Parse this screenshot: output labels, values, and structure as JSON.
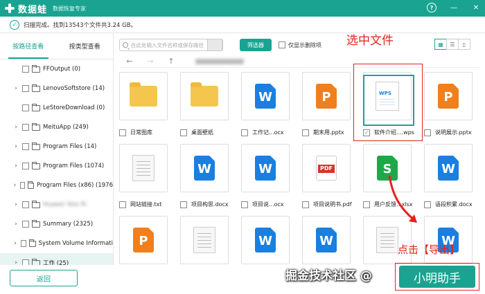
{
  "app": {
    "name": "数据蛙",
    "subtitle": "数据恢复专家"
  },
  "window": {
    "help": "?",
    "minimize": "—",
    "close": "✕"
  },
  "status": {
    "text": "扫描完成。找到13543个文件共3.24 GB。"
  },
  "tabs": {
    "by_path": "按路径查看",
    "by_type": "按类型查看"
  },
  "tree": [
    {
      "label": "FFOutput (0)",
      "expandable": false
    },
    {
      "label": "LenovoSoftstore (14)",
      "expandable": true
    },
    {
      "label": "LeStoreDownload (0)",
      "expandable": false
    },
    {
      "label": "MeituApp (249)",
      "expandable": true
    },
    {
      "label": "Program Files (14)",
      "expandable": true
    },
    {
      "label": "Program Files (1074)",
      "expandable": true
    },
    {
      "label": "Program Files (x86) (1976",
      "expandable": true
    },
    {
      "label": "Huawei Yoto Ri",
      "expandable": true
    },
    {
      "label": "Summary (2325)",
      "expandable": true
    },
    {
      "label": "System Volume Informati",
      "expandable": true
    },
    {
      "label": "工作 (25)",
      "expandable": true
    }
  ],
  "toolbar": {
    "search_placeholder": "在此处输入文件名称或保存路径",
    "filter_label": "筛选器",
    "only_deleted": "仅显示删除项"
  },
  "annotations": {
    "select_file": "选中文件",
    "click_export": "点击【导出】"
  },
  "files": [
    {
      "name": "日常图库",
      "type": "folder"
    },
    {
      "name": "桌面壁纸",
      "type": "folder"
    },
    {
      "name": "工作记...ocx",
      "type": "word"
    },
    {
      "name": "期末用.pptx",
      "type": "ppt"
    },
    {
      "name": "软件介绍....wps",
      "type": "wps",
      "checked": true
    },
    {
      "name": "说明展示.pptx",
      "type": "ppt"
    },
    {
      "name": "网站链接.txt",
      "type": "txt"
    },
    {
      "name": "项目构思.docx",
      "type": "word"
    },
    {
      "name": "项目说...ocx",
      "type": "word"
    },
    {
      "name": "项目说明书.pdf",
      "type": "pdf"
    },
    {
      "name": "用户反馈...xlsx",
      "type": "sheet"
    },
    {
      "name": "语段积累.docx",
      "type": "word"
    },
    {
      "name": "",
      "type": "ppt"
    },
    {
      "name": "",
      "type": "txt"
    },
    {
      "name": "",
      "type": "word"
    },
    {
      "name": "",
      "type": "word"
    },
    {
      "name": "",
      "type": "txt"
    },
    {
      "name": "",
      "type": "word"
    }
  ],
  "icons": {
    "word_glyph": "W",
    "ppt_glyph": "P",
    "sheet_glyph": "S",
    "pdf_tag": "PDF",
    "wps_tag": "WPS"
  },
  "footer": {
    "back_label": "返回",
    "export_label": "小明助手",
    "watermark": "掘金技术社区 @"
  },
  "colors": {
    "brand": "#1aa391",
    "annotation": "#e0241c"
  }
}
